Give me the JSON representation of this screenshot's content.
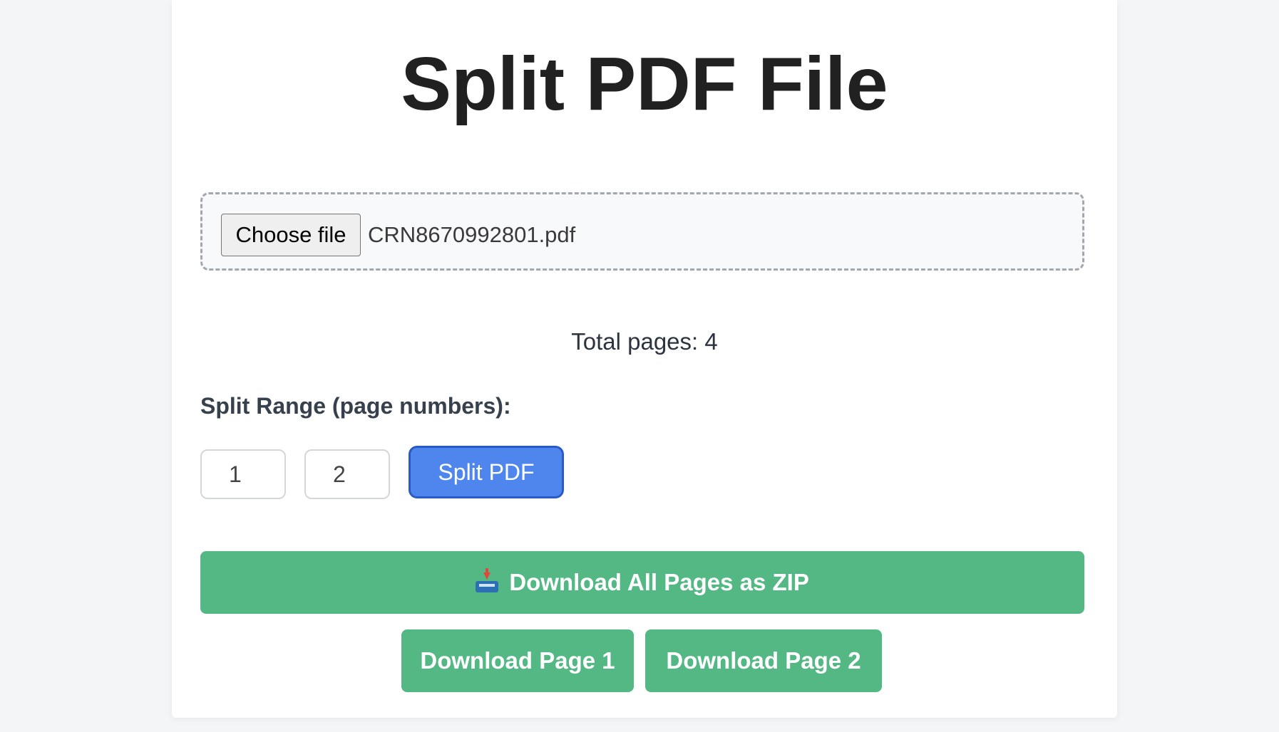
{
  "page": {
    "title": "Split PDF File"
  },
  "upload": {
    "choose_label": "Choose file",
    "file_name": "CRN8670992801.pdf"
  },
  "info": {
    "total_pages_text": "Total pages: 4"
  },
  "split": {
    "range_label": "Split Range (page numbers):",
    "start_value": "1",
    "end_value": "2",
    "split_button_label": "Split PDF"
  },
  "downloads": {
    "zip_icon": "inbox-tray-icon",
    "zip_label": "Download All Pages as ZIP",
    "pages": [
      {
        "label": "Download Page 1"
      },
      {
        "label": "Download Page 2"
      }
    ]
  },
  "colors": {
    "accent_blue": "#4f86ee",
    "download_green": "#54b884",
    "title_text": "#212121"
  }
}
